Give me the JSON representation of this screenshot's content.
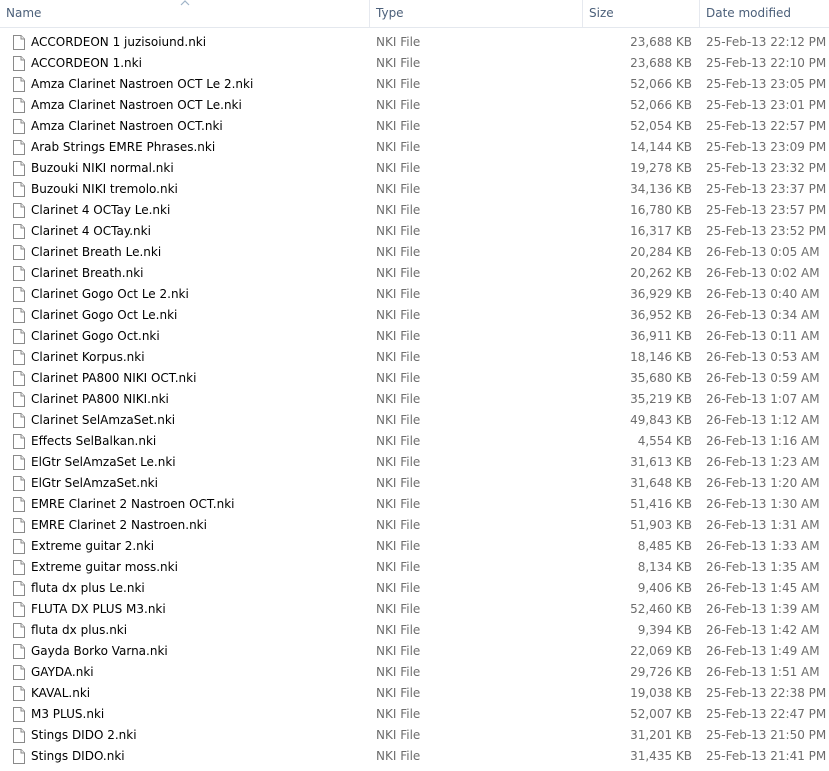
{
  "columns": {
    "name": "Name",
    "type": "Type",
    "size": "Size",
    "date": "Date modified"
  },
  "files": [
    {
      "name": "ACCORDEON 1 juzisoiund.nki",
      "type": "NKI File",
      "size": "23,688 KB",
      "date": "25-Feb-13 22:12 PM"
    },
    {
      "name": "ACCORDEON 1.nki",
      "type": "NKI File",
      "size": "23,688 KB",
      "date": "25-Feb-13 22:10 PM"
    },
    {
      "name": "Amza Clarinet Nastroen OCT Le 2.nki",
      "type": "NKI File",
      "size": "52,066 KB",
      "date": "25-Feb-13 23:05 PM"
    },
    {
      "name": "Amza Clarinet Nastroen OCT Le.nki",
      "type": "NKI File",
      "size": "52,066 KB",
      "date": "25-Feb-13 23:01 PM"
    },
    {
      "name": "Amza Clarinet Nastroen OCT.nki",
      "type": "NKI File",
      "size": "52,054 KB",
      "date": "25-Feb-13 22:57 PM"
    },
    {
      "name": "Arab Strings EMRE Phrases.nki",
      "type": "NKI File",
      "size": "14,144 KB",
      "date": "25-Feb-13 23:09 PM"
    },
    {
      "name": "Buzouki NIKI normal.nki",
      "type": "NKI File",
      "size": "19,278 KB",
      "date": "25-Feb-13 23:32 PM"
    },
    {
      "name": "Buzouki NIKI tremolo.nki",
      "type": "NKI File",
      "size": "34,136 KB",
      "date": "25-Feb-13 23:37 PM"
    },
    {
      "name": "Clarinet 4 OCTay Le.nki",
      "type": "NKI File",
      "size": "16,780 KB",
      "date": "25-Feb-13 23:57 PM"
    },
    {
      "name": "Clarinet 4 OCTay.nki",
      "type": "NKI File",
      "size": "16,317 KB",
      "date": "25-Feb-13 23:52 PM"
    },
    {
      "name": "Clarinet Breath Le.nki",
      "type": "NKI File",
      "size": "20,284 KB",
      "date": "26-Feb-13 0:05 AM"
    },
    {
      "name": "Clarinet Breath.nki",
      "type": "NKI File",
      "size": "20,262 KB",
      "date": "26-Feb-13 0:02 AM"
    },
    {
      "name": "Clarinet Gogo Oct Le 2.nki",
      "type": "NKI File",
      "size": "36,929 KB",
      "date": "26-Feb-13 0:40 AM"
    },
    {
      "name": "Clarinet Gogo Oct Le.nki",
      "type": "NKI File",
      "size": "36,952 KB",
      "date": "26-Feb-13 0:34 AM"
    },
    {
      "name": "Clarinet Gogo Oct.nki",
      "type": "NKI File",
      "size": "36,911 KB",
      "date": "26-Feb-13 0:11 AM"
    },
    {
      "name": "Clarinet Korpus.nki",
      "type": "NKI File",
      "size": "18,146 KB",
      "date": "26-Feb-13 0:53 AM"
    },
    {
      "name": "Clarinet PA800 NIKI OCT.nki",
      "type": "NKI File",
      "size": "35,680 KB",
      "date": "26-Feb-13 0:59 AM"
    },
    {
      "name": "Clarinet PA800 NIKI.nki",
      "type": "NKI File",
      "size": "35,219 KB",
      "date": "26-Feb-13 1:07 AM"
    },
    {
      "name": "Clarinet SelAmzaSet.nki",
      "type": "NKI File",
      "size": "49,843 KB",
      "date": "26-Feb-13 1:12 AM"
    },
    {
      "name": "Effects SelBalkan.nki",
      "type": "NKI File",
      "size": "4,554 KB",
      "date": "26-Feb-13 1:16 AM"
    },
    {
      "name": "ElGtr SelAmzaSet Le.nki",
      "type": "NKI File",
      "size": "31,613 KB",
      "date": "26-Feb-13 1:23 AM"
    },
    {
      "name": "ElGtr SelAmzaSet.nki",
      "type": "NKI File",
      "size": "31,648 KB",
      "date": "26-Feb-13 1:20 AM"
    },
    {
      "name": "EMRE Clarinet 2 Nastroen OCT.nki",
      "type": "NKI File",
      "size": "51,416 KB",
      "date": "26-Feb-13 1:30 AM"
    },
    {
      "name": "EMRE Clarinet 2 Nastroen.nki",
      "type": "NKI File",
      "size": "51,903 KB",
      "date": "26-Feb-13 1:31 AM"
    },
    {
      "name": "Extreme guitar 2.nki",
      "type": "NKI File",
      "size": "8,485 KB",
      "date": "26-Feb-13 1:33 AM"
    },
    {
      "name": "Extreme guitar moss.nki",
      "type": "NKI File",
      "size": "8,134 KB",
      "date": "26-Feb-13 1:35 AM"
    },
    {
      "name": "fluta dx plus Le.nki",
      "type": "NKI File",
      "size": "9,406 KB",
      "date": "26-Feb-13 1:45 AM"
    },
    {
      "name": "FLUTA DX PLUS M3.nki",
      "type": "NKI File",
      "size": "52,460 KB",
      "date": "26-Feb-13 1:39 AM"
    },
    {
      "name": "fluta dx plus.nki",
      "type": "NKI File",
      "size": "9,394 KB",
      "date": "26-Feb-13 1:42 AM"
    },
    {
      "name": "Gayda Borko Varna.nki",
      "type": "NKI File",
      "size": "22,069 KB",
      "date": "26-Feb-13 1:49 AM"
    },
    {
      "name": "GAYDA.nki",
      "type": "NKI File",
      "size": "29,726 KB",
      "date": "26-Feb-13 1:51 AM"
    },
    {
      "name": "KAVAL.nki",
      "type": "NKI File",
      "size": "19,038 KB",
      "date": "25-Feb-13 22:38 PM"
    },
    {
      "name": "M3 PLUS.nki",
      "type": "NKI File",
      "size": "52,007 KB",
      "date": "25-Feb-13 22:47 PM"
    },
    {
      "name": "Stings DIDO 2.nki",
      "type": "NKI File",
      "size": "31,201 KB",
      "date": "25-Feb-13 21:50 PM"
    },
    {
      "name": "Stings DIDO.nki",
      "type": "NKI File",
      "size": "31,435 KB",
      "date": "25-Feb-13 21:41 PM"
    }
  ],
  "icons": {
    "file": "document-icon",
    "sort": "sort-ascending-icon"
  },
  "colors": {
    "header_text": "#4c607a",
    "secondary_text": "#6d6d6d",
    "divider": "#e4e8ee"
  }
}
